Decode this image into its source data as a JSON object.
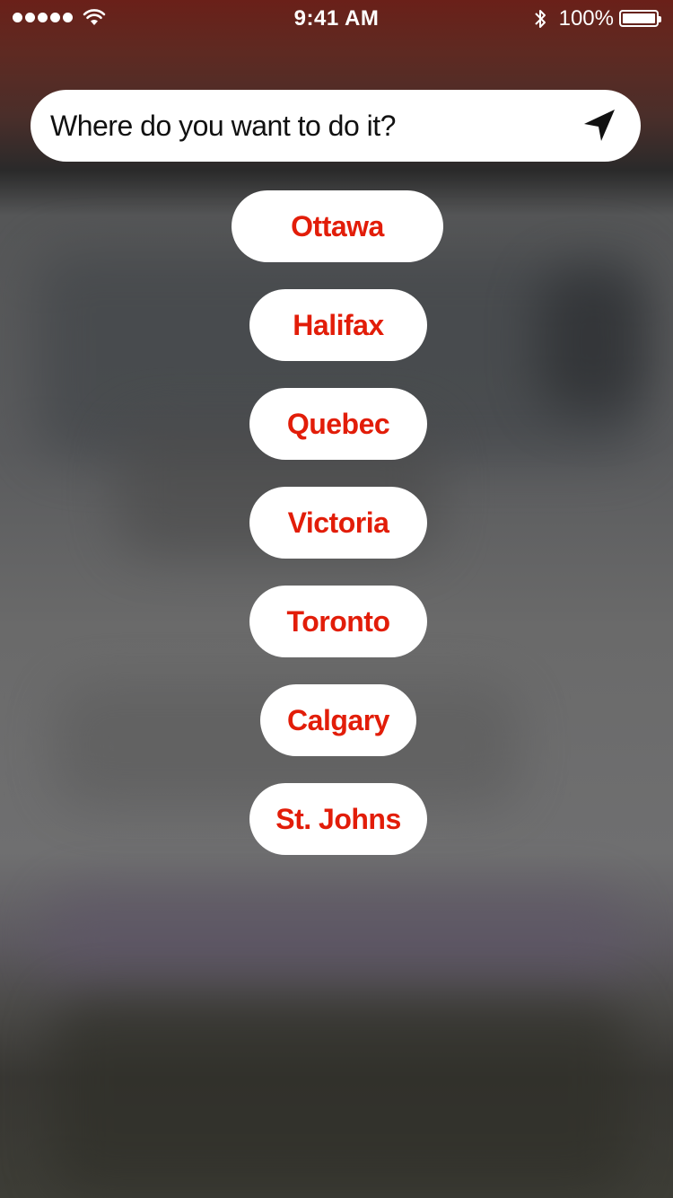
{
  "status_bar": {
    "time": "9:41 AM",
    "battery_percent": "100%",
    "battery_level": 1.0
  },
  "search": {
    "placeholder": "Where do you want to do it?",
    "value": "",
    "locate_icon": "location-arrow-icon"
  },
  "cities": [
    {
      "label": "Ottawa"
    },
    {
      "label": "Halifax"
    },
    {
      "label": "Quebec"
    },
    {
      "label": "Victoria"
    },
    {
      "label": "Toronto"
    },
    {
      "label": "Calgary"
    },
    {
      "label": "St. Johns"
    }
  ],
  "colors": {
    "accent": "#e21d09",
    "pill_background": "#ffffff"
  }
}
